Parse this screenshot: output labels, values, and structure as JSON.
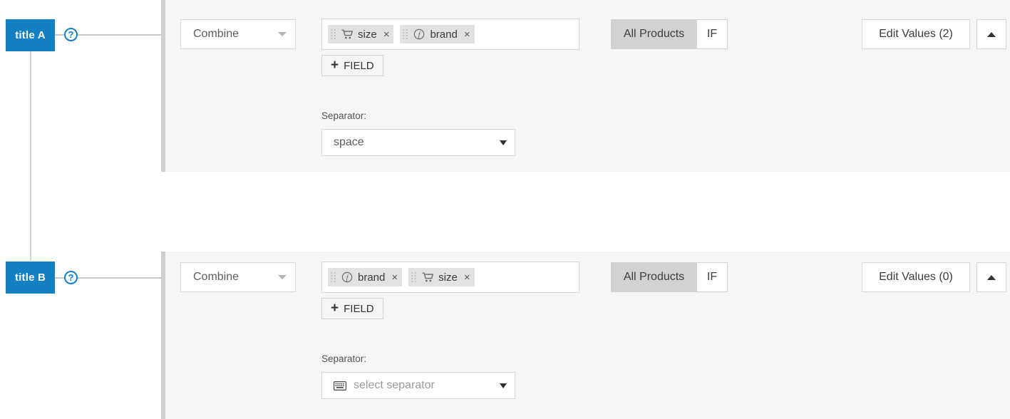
{
  "nodes": [
    {
      "title": "title A",
      "help_icon": "help-circle-icon",
      "help_glyph": "?",
      "operation": "Combine",
      "fields": [
        {
          "label": "size",
          "icon": "cart-icon",
          "remove": "×"
        },
        {
          "label": "brand",
          "icon": "function-icon",
          "remove": "×"
        }
      ],
      "add_field_label": "FIELD",
      "add_field_plus": "+",
      "separator_label": "Separator:",
      "separator_value": "space",
      "separator_is_placeholder": false,
      "separator_icon": "",
      "scope_all_label": "All Products",
      "scope_if_label": "IF",
      "scope_active": "All Products",
      "edit_values_label": "Edit Values (2)",
      "collapse_icon": "chevron-up-icon"
    },
    {
      "title": "title B",
      "help_icon": "help-circle-icon",
      "help_glyph": "?",
      "operation": "Combine",
      "fields": [
        {
          "label": "brand",
          "icon": "function-icon",
          "remove": "×"
        },
        {
          "label": "size",
          "icon": "cart-icon",
          "remove": "×"
        }
      ],
      "add_field_label": "FIELD",
      "add_field_plus": "+",
      "separator_label": "Separator:",
      "separator_value": "select separator",
      "separator_is_placeholder": true,
      "separator_icon": "keyboard-icon",
      "scope_all_label": "All Products",
      "scope_if_label": "IF",
      "scope_active": "All Products",
      "edit_values_label": "Edit Values (0)",
      "collapse_icon": "chevron-up-icon"
    }
  ],
  "colors": {
    "badge_blue": "#1380c4",
    "panel_bg": "#f5f5f5",
    "panel_rail": "#cfcfcf",
    "token_bg": "#e2e2e2",
    "toggle_active": "#d2d2d2",
    "connector": "#d0d0d0"
  }
}
